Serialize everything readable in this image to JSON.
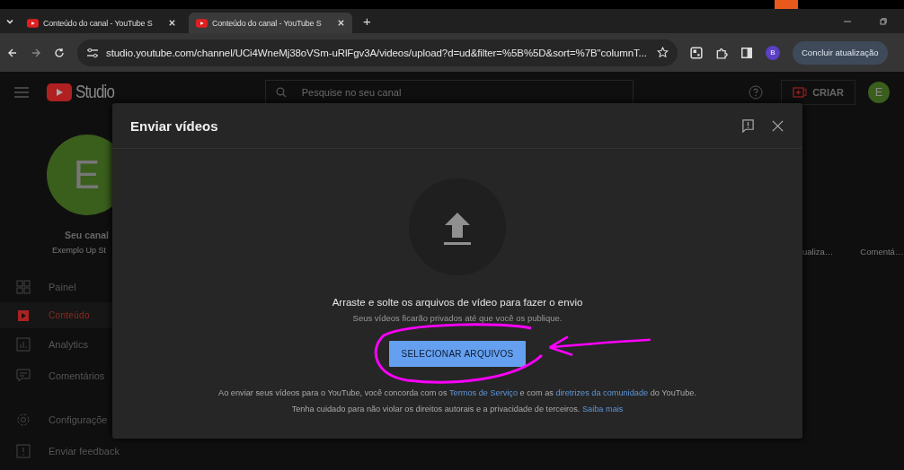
{
  "browser": {
    "tabs": [
      {
        "title": "Conteúdo do canal - YouTube S",
        "selected": false
      },
      {
        "title": "Conteúdo do canal - YouTube S",
        "selected": true
      }
    ],
    "new_tab": "+",
    "url": "studio.youtube.com/channel/UCi4WneMj38oVSm-uRlFgv3A/videos/upload?d=ud&filter=%5B%5D&sort=%7B\"columnT...",
    "profile_initial": "B",
    "update_button": "Concluir atualização"
  },
  "studio": {
    "logo": "Studio",
    "search": {
      "placeholder": "Pesquise no seu canal"
    },
    "create_button": "CRIAR",
    "avatar_initial": "E",
    "channel": {
      "avatar_initial": "E",
      "name": "Seu canal",
      "handle": "Exemplo Up St"
    },
    "nav": [
      {
        "label": "Painel",
        "selected": false
      },
      {
        "label": "Conteúdo",
        "selected": true
      },
      {
        "label": "Analytics",
        "selected": false
      },
      {
        "label": "Comentários",
        "selected": false
      },
      {
        "label": "Configuraçõe",
        "selected": false
      },
      {
        "label": "Enviar feedback",
        "selected": false
      }
    ],
    "column_headers": [
      "ualiza…",
      "Comentá…"
    ]
  },
  "dialog": {
    "title": "Enviar vídeos",
    "heading": "Arraste e solte os arquivos de vídeo para fazer o envio",
    "subtext": "Seus vídeos ficarão privados até que você os publique.",
    "select_button": "SELECIONAR ARQUIVOS",
    "terms": [
      {
        "kind": "text",
        "text": "Ao enviar seus vídeos para o YouTube, você concorda com os"
      },
      {
        "kind": "link",
        "text": "Termos de Serviço"
      },
      {
        "kind": "text",
        "text": "e com as"
      },
      {
        "kind": "link",
        "text": "diretrizes da comunidade"
      },
      {
        "kind": "text",
        "text": "do YouTube."
      }
    ],
    "copyright": [
      {
        "kind": "text",
        "text": "Tenha cuidado para não violar os direitos autorais e a privacidade de terceiros."
      },
      {
        "kind": "link",
        "text": "Saiba mais"
      }
    ]
  }
}
